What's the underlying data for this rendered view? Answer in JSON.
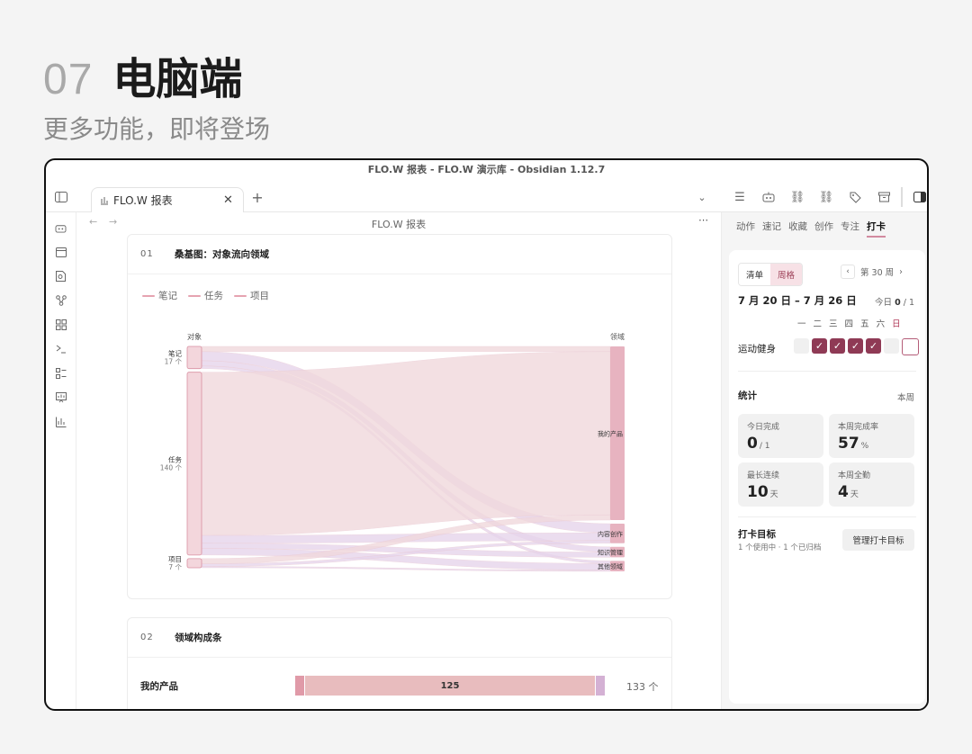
{
  "hero": {
    "number": "07",
    "title": "电脑端",
    "subtitle": "更多功能，即将登场"
  },
  "window": {
    "title": "FLO.W 报表 - FLO.W 演示库 - Obsidian 1.12.7",
    "tab_label": "FLO.W 报表",
    "page_title": "FLO.W 报表"
  },
  "icons": {
    "sidebar_toggle": "sidebar-toggle-icon",
    "ribbon": [
      "robot-icon",
      "calendar-icon",
      "search-file-icon",
      "graph-icon",
      "grid-icon",
      "terminal-icon",
      "list-icon",
      "chart-board-icon",
      "bar-chart-icon"
    ],
    "right_tools": [
      "list-icon",
      "robot-icon",
      "link-add-icon",
      "link-add-alt-icon",
      "tag-icon",
      "archive-icon",
      "panel-toggle-icon"
    ]
  },
  "card1": {
    "num": "01",
    "title": "桑基图：对象流向领域"
  },
  "legend": [
    "笔记",
    "任务",
    "项目"
  ],
  "chart_data": {
    "type": "sankey",
    "left_header": "对象",
    "right_header": "领域",
    "sources": [
      {
        "name": "笔记",
        "count_label": "17 个",
        "value": 17
      },
      {
        "name": "任务",
        "count_label": "140 个",
        "value": 140
      },
      {
        "name": "项目",
        "count_label": "7 个",
        "value": 7
      }
    ],
    "targets": [
      {
        "name": "我的产品",
        "value": 133
      },
      {
        "name": "内容创作",
        "value": 15
      },
      {
        "name": "知识管理",
        "value": 8
      },
      {
        "name": "其他领域",
        "value": 8
      }
    ],
    "links": [
      {
        "source": "笔记",
        "target": "我的产品",
        "value": 4
      },
      {
        "source": "笔记",
        "target": "内容创作",
        "value": 7
      },
      {
        "source": "笔记",
        "target": "知识管理",
        "value": 4
      },
      {
        "source": "笔记",
        "target": "其他领域",
        "value": 2
      },
      {
        "source": "任务",
        "target": "我的产品",
        "value": 125
      },
      {
        "source": "任务",
        "target": "内容创作",
        "value": 6
      },
      {
        "source": "任务",
        "target": "知识管理",
        "value": 4
      },
      {
        "source": "任务",
        "target": "其他领域",
        "value": 5
      },
      {
        "source": "项目",
        "target": "我的产品",
        "value": 4
      },
      {
        "source": "项目",
        "target": "内容创作",
        "value": 2
      },
      {
        "source": "项目",
        "target": "其他领域",
        "value": 1
      }
    ],
    "colors": {
      "node_left": "#f3d6dc",
      "node_border": "#d98fa1",
      "node_right": "#e7b3c0",
      "link": "#f1d9dd",
      "link_alt": "#e7d5ec"
    }
  },
  "card2": {
    "num": "02",
    "title": "领域构成条",
    "row": {
      "name": "我的产品",
      "bar_value": "125",
      "count": "133 个"
    }
  },
  "side": {
    "tabs": [
      "动作",
      "速记",
      "收藏",
      "创作",
      "专注",
      "打卡"
    ],
    "view_toggle": [
      "清单",
      "周格"
    ],
    "week_label": "第 30 周",
    "date_range": "7 月 20 日 – 7 月 26 日",
    "today_prefix": "今日",
    "today_value": "0",
    "today_total": "/ 1",
    "weekdays": [
      "一",
      "二",
      "三",
      "四",
      "五",
      "六",
      "日"
    ],
    "habit": {
      "name": "运动健身",
      "days": [
        false,
        true,
        true,
        true,
        true,
        false,
        false
      ]
    },
    "stats_label": "统计",
    "stats_range": "本周",
    "stats": [
      {
        "label": "今日完成",
        "value": "0",
        "unit": "/ 1"
      },
      {
        "label": "本周完成率",
        "value": "57",
        "unit": "%"
      },
      {
        "label": "最长连续",
        "value": "10",
        "unit": "天"
      },
      {
        "label": "本周全勤",
        "value": "4",
        "unit": "天"
      }
    ],
    "goal_label": "打卡目标",
    "goal_sub": "1 个使用中 · 1 个已归档",
    "goal_button": "管理打卡目标"
  },
  "colors": {
    "accent": "#8f3a55",
    "accent_soft": "#f7e1e6"
  }
}
